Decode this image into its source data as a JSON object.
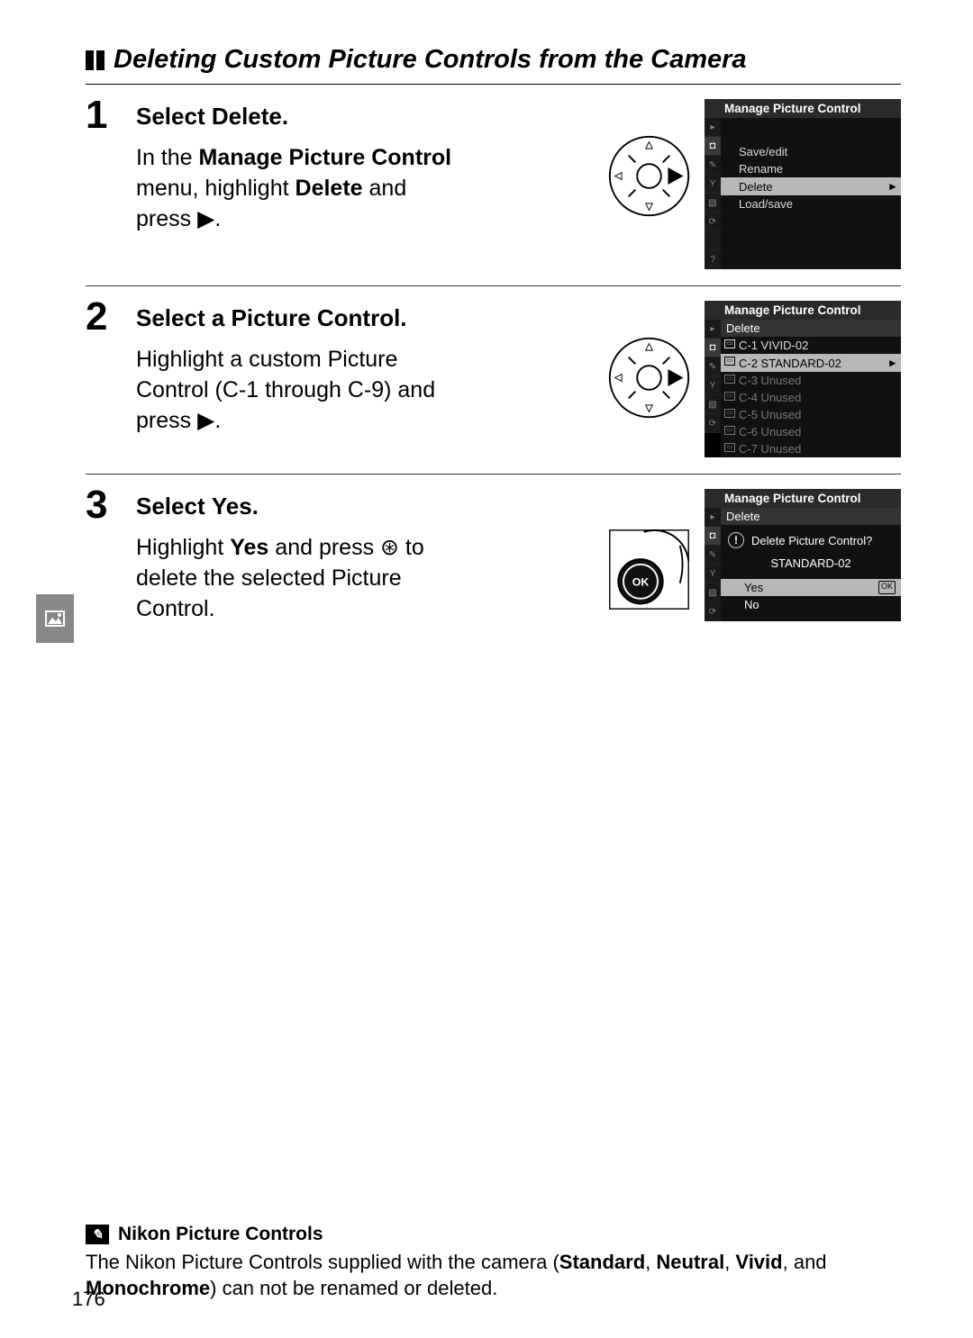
{
  "title": "Deleting Custom Picture Controls from the Camera",
  "steps": [
    {
      "num": "1",
      "heading_prefix": "Select ",
      "heading_bold": "Delete",
      "heading_suffix": ".",
      "text_parts": [
        "In the ",
        "Manage Picture Control",
        " menu, highlight ",
        "Delete",
        " and press ",
        "▶",
        "."
      ],
      "screen": {
        "title": "Manage Picture Control",
        "items": [
          {
            "label": "Save/edit",
            "selected": false
          },
          {
            "label": "Rename",
            "selected": false
          },
          {
            "label": "Delete",
            "selected": true
          },
          {
            "label": "Load/save",
            "selected": false
          }
        ]
      }
    },
    {
      "num": "2",
      "heading_prefix": "Select a Picture Control.",
      "heading_bold": "",
      "heading_suffix": "",
      "text_parts": [
        "Highlight a custom Picture Control (C-1 through C-9) and press ",
        "▶",
        "."
      ],
      "screen": {
        "title": "Manage Picture Control",
        "sub": "Delete",
        "items": [
          {
            "label": "C-1 VIVID-02",
            "selected": false
          },
          {
            "label": "C-2 STANDARD-02",
            "selected": true
          },
          {
            "label": "C-3 Unused",
            "selected": false,
            "dim": true
          },
          {
            "label": "C-4 Unused",
            "selected": false,
            "dim": true
          },
          {
            "label": "C-5 Unused",
            "selected": false,
            "dim": true
          },
          {
            "label": "C-6 Unused",
            "selected": false,
            "dim": true
          },
          {
            "label": "C-7 Unused",
            "selected": false,
            "dim": true
          }
        ]
      }
    },
    {
      "num": "3",
      "heading_prefix": "Select ",
      "heading_bold": "Yes",
      "heading_suffix": ".",
      "text_parts": [
        "Highlight ",
        "Yes",
        " and press ",
        "⊛",
        " to delete the selected Picture Control."
      ],
      "screen": {
        "title": "Manage Picture Control",
        "sub": "Delete",
        "prompt": "Delete Picture Control?",
        "name": "STANDARD-02",
        "options": [
          {
            "label": "Yes",
            "selected": true,
            "ok": true
          },
          {
            "label": "No",
            "selected": false
          }
        ]
      }
    }
  ],
  "note": {
    "head": "Nikon Picture Controls",
    "body_parts": [
      "The Nikon Picture Controls supplied with the camera (",
      "Standard",
      ", ",
      "Neutral",
      ", ",
      "Vivid",
      ", and ",
      "Monochrome",
      ") can not be renamed or deleted."
    ]
  },
  "page_number": "176",
  "ok_label": "OK"
}
